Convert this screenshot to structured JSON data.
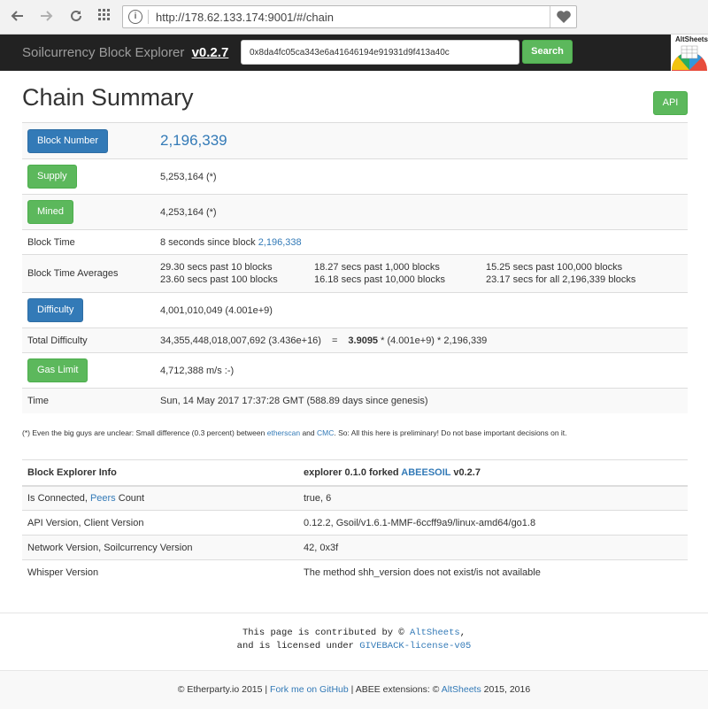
{
  "browser": {
    "url": "http://178.62.133.174:9001/#/chain"
  },
  "navbar": {
    "brand": "Soilcurrency Block Explorer",
    "version": "v0.2.7",
    "search_value": "0x8da4fc05ca343e6a41646194e91931d9f413a40c",
    "search_label": "Search",
    "logo_text": "AltSheets"
  },
  "page": {
    "title": "Chain Summary",
    "api_label": "API"
  },
  "summary": {
    "block_number_label": "Block Number",
    "block_number": "2,196,339",
    "supply_label": "Supply",
    "supply": "5,253,164 (*)",
    "mined_label": "Mined",
    "mined": "4,253,164 (*)",
    "block_time_label": "Block Time",
    "block_time_prefix": "8 seconds since block",
    "block_time_block": "2,196,338",
    "averages_label": "Block Time Averages",
    "averages": [
      "29.30 secs past 10 blocks",
      "18.27 secs past 1,000 blocks",
      "15.25 secs past 100,000 blocks",
      "23.60 secs past 100 blocks",
      "16.18 secs past 10,000 blocks",
      "23.17 secs for all 2,196,339 blocks"
    ],
    "difficulty_label": "Difficulty",
    "difficulty": "4,001,010,049 (4.001e+9)",
    "total_difficulty_label": "Total Difficulty",
    "total_difficulty": "34,355,448,018,007,692 (3.436e+16)",
    "equals": "=",
    "total_factor": "3.9095",
    "total_rest": "* (4.001e+9) * 2,196,339",
    "gas_limit_label": "Gas Limit",
    "gas_limit": "4,712,388 m/s :-)",
    "time_label": "Time",
    "time": "Sun, 14 May 2017 17:37:28 GMT (588.89 days since genesis)"
  },
  "footnote": {
    "part1": "(*) Even the big guys are unclear: Small difference (0.3 percent) between",
    "link1": "etherscan",
    "part2": "and",
    "link2": "CMC",
    "part3": ". So: All this here is preliminary! Do not base important decisions on it."
  },
  "info": {
    "header_label": "Block Explorer Info",
    "header_prefix": "explorer 0.1.0 forked",
    "header_link": "ABEESOIL",
    "header_suffix": "v0.2.7",
    "connected_prefix": "Is Connected,",
    "connected_link": "Peers",
    "connected_suffix": "Count",
    "connected_value": "true, 6",
    "api_label": "API Version, Client Version",
    "api_value": "0.12.2, Gsoil/v1.6.1-MMF-6ccff9a9/linux-amd64/go1.8",
    "network_label": "Network Version, Soilcurrency Version",
    "network_value": "42, 0x3f",
    "whisper_label": "Whisper Version",
    "whisper_value": "The method shh_version does not exist/is not available"
  },
  "contrib": {
    "line1_prefix": "This page is contributed by ©",
    "line1_link": "AltSheets",
    "line1_suffix": ",",
    "line2_prefix": "and is licensed under",
    "line2_link": "GIVEBACK-license-v05"
  },
  "footer": {
    "part1": "© Etherparty.io 2015 |",
    "link1": "Fork me on GitHub",
    "part2": "| ABEE extensions: ©",
    "link2": "AltSheets",
    "part3": "2015, 2016"
  },
  "colors": {
    "primary": "#337ab7",
    "success": "#5cb85c",
    "navbar": "#222222"
  }
}
